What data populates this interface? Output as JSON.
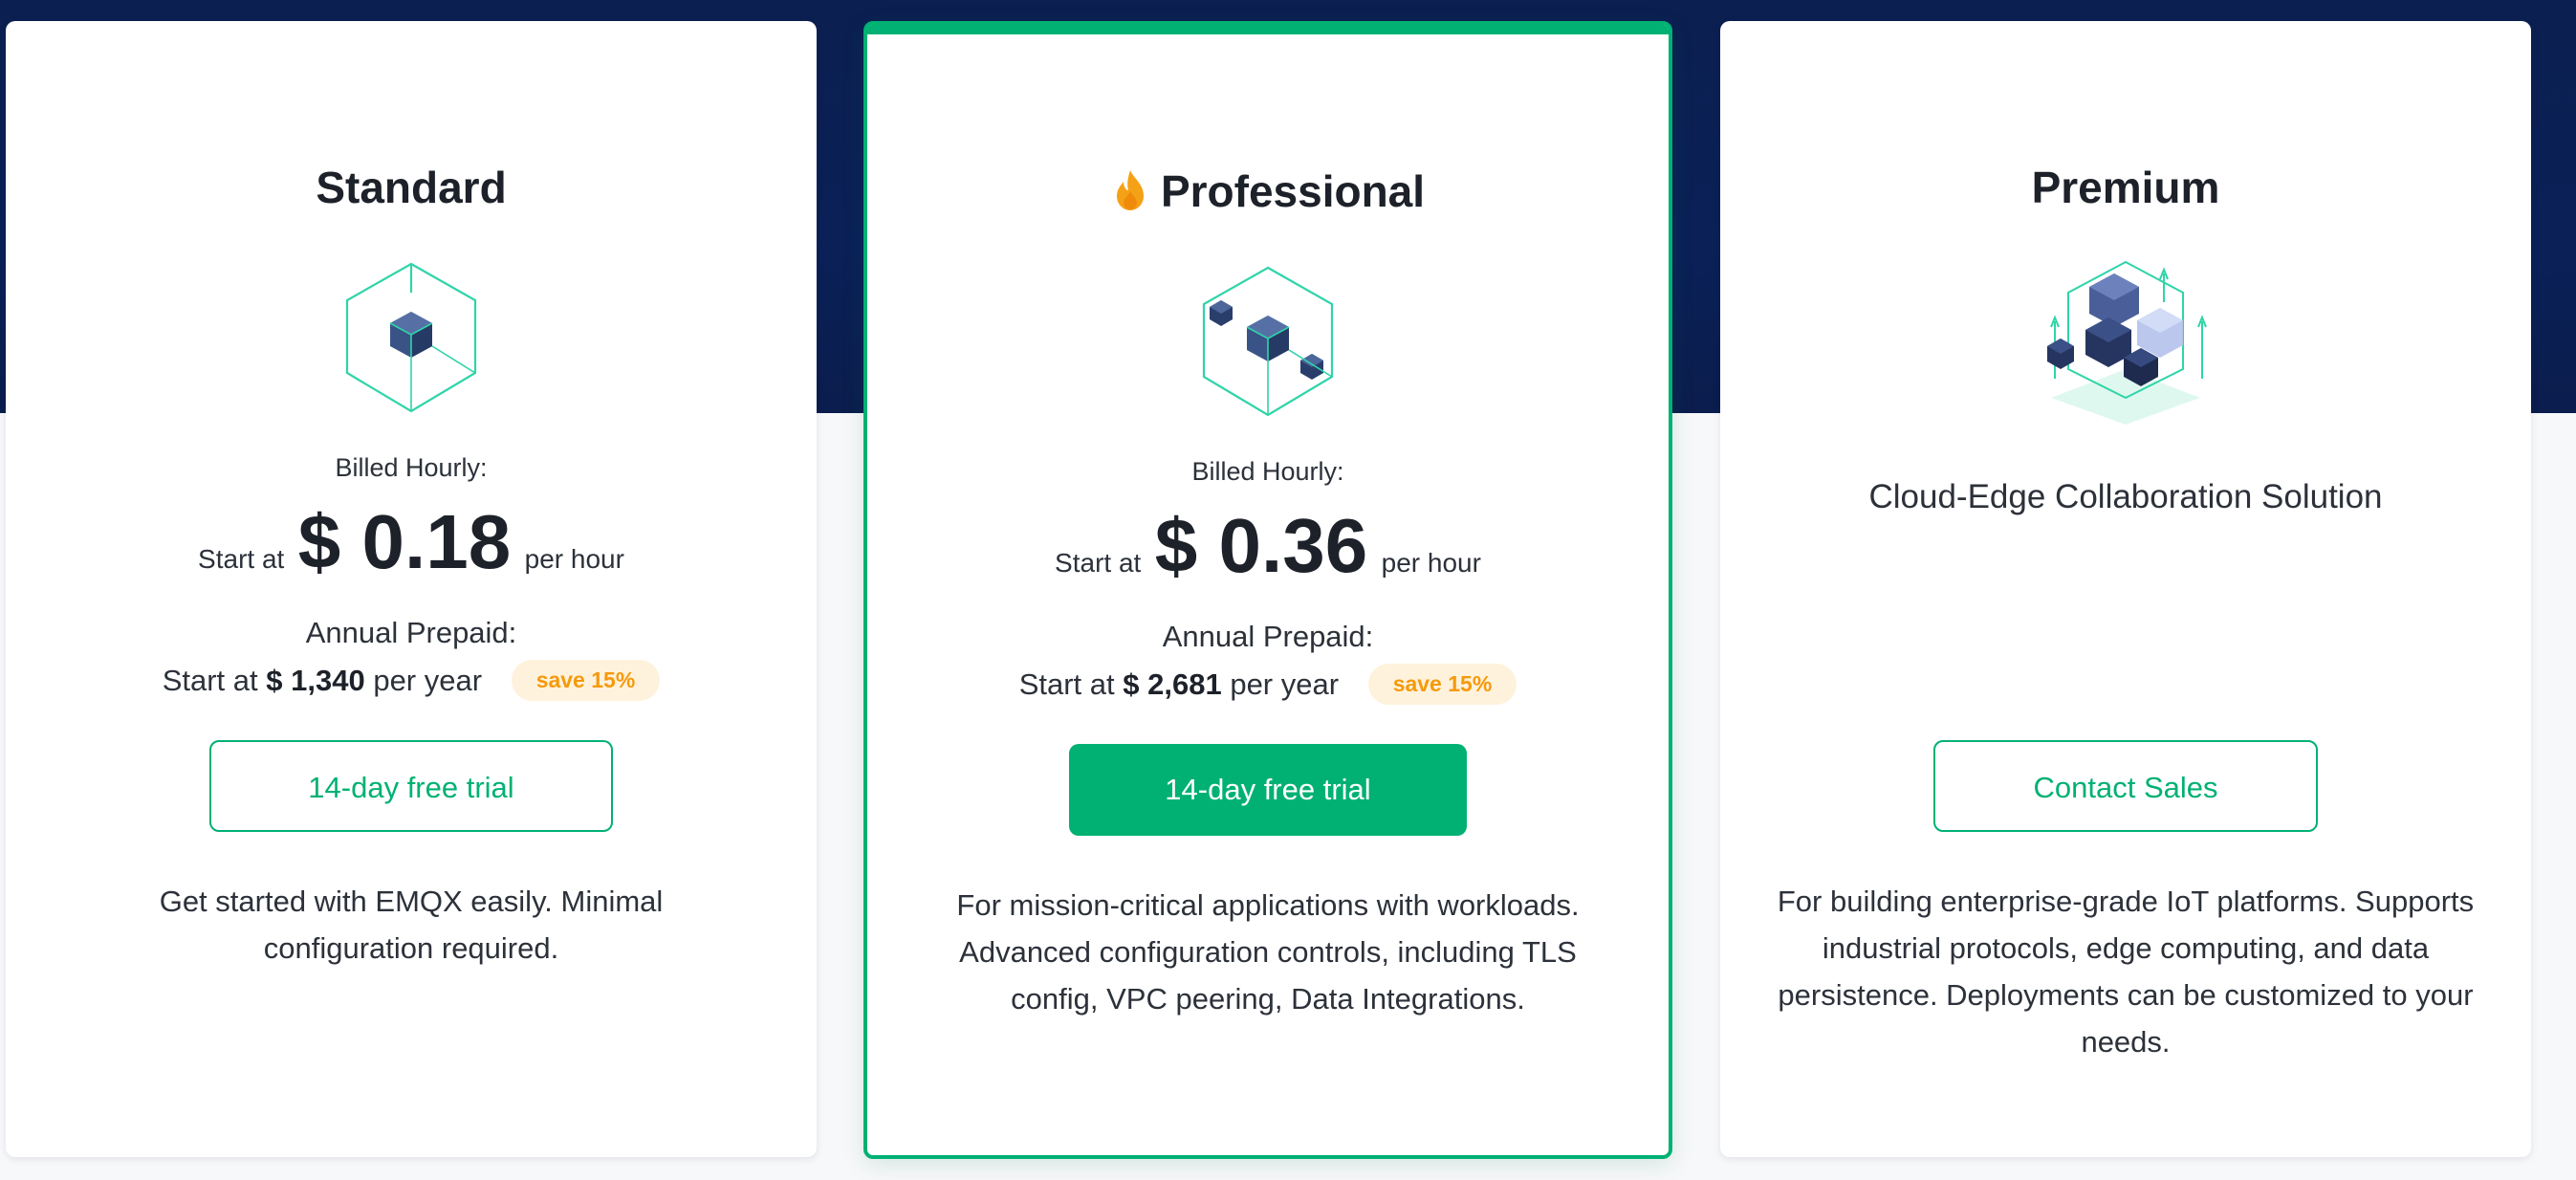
{
  "colors": {
    "accent": "#00b173",
    "header_band": "#0a2057",
    "badge_bg": "#fff2dc",
    "badge_text": "#f59a0c"
  },
  "plans": {
    "standard": {
      "title": "Standard",
      "icon": "single-cube-icon",
      "billed_label": "Billed Hourly:",
      "price_prefix": "Start at",
      "price": "$ 0.18",
      "price_suffix": "per hour",
      "annual_label": "Annual Prepaid:",
      "annual_prefix": "Start at",
      "annual_price": "$ 1,340",
      "annual_suffix": "per year",
      "save_badge": "save 15%",
      "cta": "14-day free trial",
      "description": "Get started with EMQX easily. Minimal configuration required."
    },
    "professional": {
      "title": "Professional",
      "title_icon": "flame-icon",
      "icon": "multi-cube-icon",
      "billed_label": "Billed Hourly:",
      "price_prefix": "Start at",
      "price": "$ 0.36",
      "price_suffix": "per hour",
      "annual_label": "Annual Prepaid:",
      "annual_prefix": "Start at",
      "annual_price": "$ 2,681",
      "annual_suffix": "per year",
      "save_badge": "save 15%",
      "cta": "14-day free trial",
      "description": "For mission-critical applications with workloads. Advanced configuration controls, including TLS config, VPC peering, Data Integrations."
    },
    "premium": {
      "title": "Premium",
      "icon": "cube-cluster-icon",
      "subtitle": "Cloud-Edge Collaboration Solution",
      "cta": "Contact Sales",
      "description": "For building enterprise-grade IoT platforms. Supports industrial protocols, edge computing, and data persistence. Deployments can be customized to your needs."
    }
  }
}
